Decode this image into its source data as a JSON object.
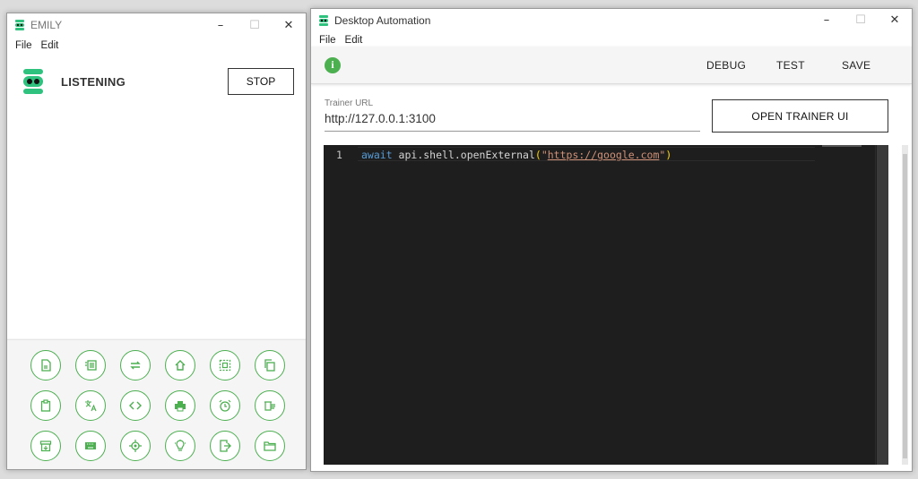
{
  "emily": {
    "title": "EMILY",
    "menu": [
      "File",
      "Edit"
    ],
    "status": "LISTENING",
    "stop_label": "STOP",
    "tools": [
      "document-icon",
      "list-icon",
      "repeat-icon",
      "home-icon",
      "select-icon",
      "copy-icon",
      "clipboard-icon",
      "translate-icon",
      "code-icon",
      "print-icon",
      "alarm-icon",
      "delete-list-icon",
      "archive-icon",
      "keyboard-icon",
      "target-icon",
      "lightbulb-icon",
      "exit-icon",
      "folder-icon"
    ]
  },
  "automation": {
    "title": "Desktop Automation",
    "menu": [
      "File",
      "Edit"
    ],
    "toolbar": {
      "debug": "DEBUG",
      "test": "TEST",
      "save": "SAVE"
    },
    "trainer_url_label": "Trainer URL",
    "trainer_url": "http://127.0.0.1:3100",
    "open_trainer_label": "OPEN TRAINER UI",
    "editor": {
      "line_number": "1",
      "keyword": "await",
      "call": " api.shell.openExternal",
      "paren_open": "(",
      "quote_open": "\"",
      "url": "https://google.com",
      "quote_close": "\"",
      "paren_close": ")"
    }
  },
  "colors": {
    "accent": "#4caf50",
    "logo": "#2ec27e",
    "editor_bg": "#1e1e1e"
  }
}
